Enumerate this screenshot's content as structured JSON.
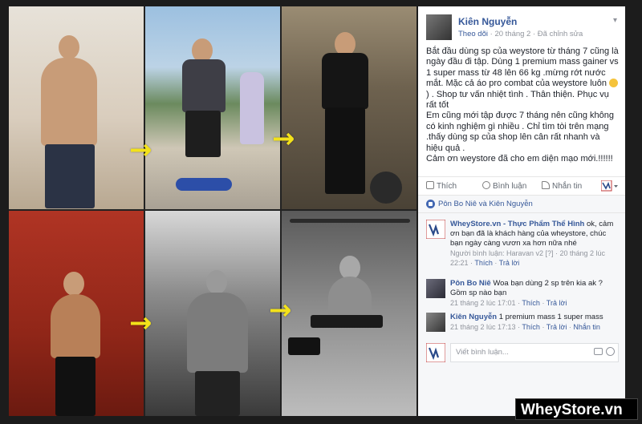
{
  "post": {
    "author": "Kiên Nguyễn",
    "follow": "Theo dõi",
    "date": "20 tháng 2",
    "edited": "Đã chỉnh sửa",
    "body_1": "Bắt đầu dùng sp của weystore từ tháng 7 cũng là ngày đầu đi tập. Dùng 1 premium mass gainer vs 1 super mass từ 48 lên 66 kg .mừng rớt nước mắt. Mặc cả áo pro combat của weystore luôn",
    "body_2": ") . Shop tư vấn nhiệt tình . Thân thiện. Phục vụ rất tốt",
    "body_3": "Em cũng mới tập được 7 tháng nên cũng không có kinh nghiệm gì nhiều . Chỉ tìm tòi trên mạng .thấy dùng sp của shop lên cân rất nhanh và hiệu quả .",
    "body_4": "Cảm ơn weystore đã cho em diện mạo mới.!!!!!!"
  },
  "actions": {
    "like": "Thích",
    "comment": "Bình luận",
    "share": "Nhắn tin"
  },
  "reactions": {
    "text": "Pôn Bo Niê và Kiên Nguyễn"
  },
  "comments": [
    {
      "name": "WheyStore.vn - Thực Phẩm Thể Hình",
      "text": "ok, cảm ơn bạn đã là khách hàng của wheystore, chúc bạn ngày càng vươn xa hơn nữa nhé",
      "meta_prefix": "Người bình luận: Haravan v2 [?] · 20 tháng 2 lúc 22:21 ·",
      "like": "Thích",
      "reply": "Trả lời"
    },
    {
      "name": "Pôn Bo Niê",
      "text": "Woa bạn dùng 2 sp trên kia ak ? Gồm sp nào bạn",
      "meta_prefix": "21 tháng 2 lúc 17:01 ·",
      "like": "Thích",
      "reply": "Trả lời"
    },
    {
      "name": "Kiên Nguyễn",
      "text": "1 premium mass 1 super mass",
      "meta_prefix": "21 tháng 2 lúc 17:13 ·",
      "like": "Thích",
      "reply": "Trả lời",
      "message": "Nhắn tin"
    }
  ],
  "comment_box": {
    "placeholder": "Viết bình luận..."
  },
  "brand_watermark": "WheyStore.vn",
  "icons": {
    "avatar": "avatar",
    "chevron": "chevron-down-icon",
    "like": "like-icon",
    "comment": "comment-icon",
    "share": "share-icon",
    "camera": "camera-icon",
    "emoji": "emoji-icon"
  },
  "colors": {
    "link": "#365899",
    "arrow": "#f3e21a",
    "fb_blue": "#4267b2"
  }
}
